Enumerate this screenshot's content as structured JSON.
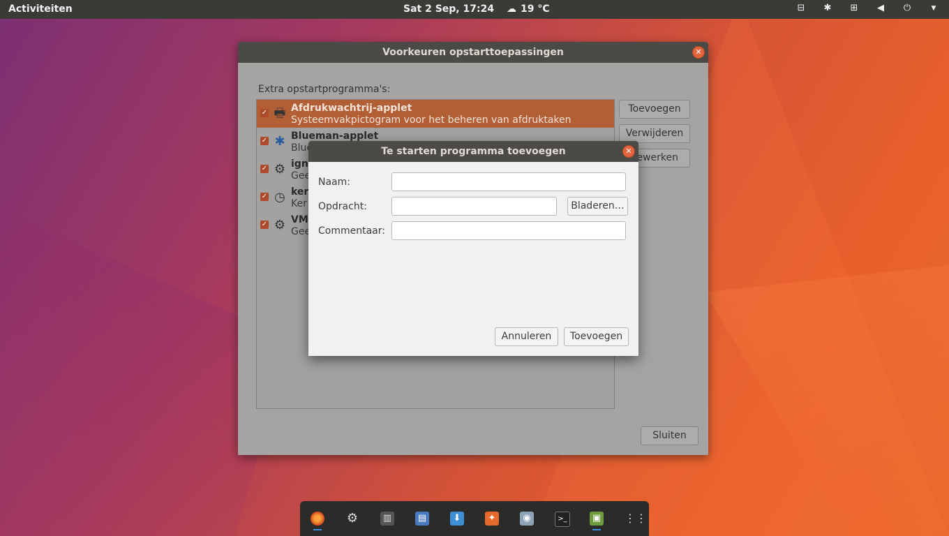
{
  "topbar": {
    "activities": "Activiteiten",
    "clock": "Sat  2 Sep, 17:24",
    "weather_temp": "19 °C",
    "tray_icons": [
      "radio-icon",
      "bluetooth-icon",
      "network-icon",
      "volume-icon",
      "power-icon",
      "menu-arrow-icon"
    ]
  },
  "main_dialog": {
    "title": "Voorkeuren opstarttoepassingen",
    "list_label": "Extra opstartprogramma's:",
    "items": [
      {
        "name": "Afdrukwachtrij-applet",
        "desc": "Systeemvakpictogram voor het beheren van afdruktaken",
        "icon": "printer-icon",
        "checked": true,
        "selected": true
      },
      {
        "name": "Blueman-applet",
        "desc": "Blue",
        "icon": "bluetooth-icon",
        "checked": true,
        "selected": false
      },
      {
        "name": "ign",
        "desc": "Gee",
        "icon": "gears-icon",
        "checked": true,
        "selected": false
      },
      {
        "name": "ker",
        "desc": "Ker",
        "icon": "clock-icon",
        "checked": true,
        "selected": false
      },
      {
        "name": "VM",
        "desc": "Gee",
        "icon": "gears-icon",
        "checked": true,
        "selected": false
      }
    ],
    "buttons": {
      "add": "Toevoegen",
      "remove": "Verwijderen",
      "edit": "ewerken",
      "close": "Sluiten"
    }
  },
  "add_dialog": {
    "title": "Te starten programma toevoegen",
    "name_label": "Naam:",
    "command_label": "Opdracht:",
    "comment_label": "Commentaar:",
    "name_value": "",
    "command_value": "",
    "comment_value": "",
    "browse": "Bladeren…",
    "cancel": "Annuleren",
    "add": "Toevoegen"
  },
  "dock": {
    "items": [
      "firefox-icon",
      "settings-icon",
      "tweaks-icon",
      "files-icon",
      "software-icon",
      "ubuntu-software-icon",
      "screenshot-icon",
      "terminal-icon",
      "startup-apps-icon",
      "app-grid-icon"
    ]
  },
  "colors": {
    "accent": "#b35f35",
    "titlebar": "#4b4a47",
    "close": "#e4643d"
  }
}
